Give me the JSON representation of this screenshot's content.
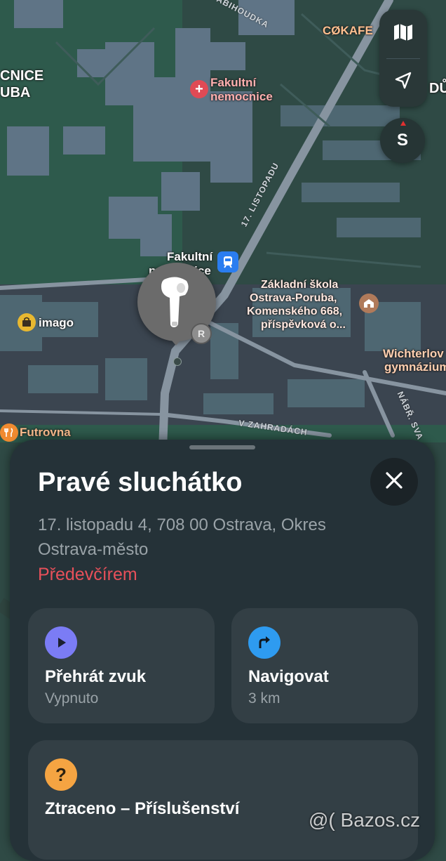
{
  "map": {
    "labels": {
      "hospital_left_line1": "CNICE",
      "hospital_left_line2": "UBA",
      "fakultni_nemocnice_line1": "Fakultní",
      "fakultni_nemocnice_line2": "nemocnice",
      "tram_stop_line1": "Fakultní",
      "tram_stop_line2": "nemocnice",
      "school_line1": "Základní škola",
      "school_line2": "Ostrava-Poruba,",
      "school_line3": "Komenského 668,",
      "school_line4": "příspěvková o...",
      "imago": "imago",
      "futrovna": "Futrovna",
      "cokafe": "CØKAFE",
      "wichterle_line1": "Wichterlov",
      "wichterle_line2": "gymnázium",
      "right_edge": "DŮ"
    },
    "streets": {
      "listopadu": "17. LISTOPADU",
      "abihoudka": "ABIHOUDKA",
      "zahradou": "V ZAHRADÁCH",
      "nabrezi": "NÁBŘ. SVA"
    },
    "icons": [
      "hospital-icon",
      "tram-icon",
      "shopping-bag-icon",
      "fork-knife-icon",
      "school-icon"
    ],
    "colors": {
      "map_bg": "#2f4a45",
      "poi_red": "#e04a55",
      "tram_blue": "#2a7df0",
      "shop_yellow": "#e8b830",
      "food_orange": "#f08a30",
      "school_brown": "#b07a5a"
    }
  },
  "controls": {
    "map_mode_icon": "map-icon",
    "location_icon": "location-arrow-icon",
    "compass_label": "S"
  },
  "pin": {
    "device_icon": "airpod-icon",
    "badge": "R"
  },
  "sheet": {
    "title": "Pravé sluchátko",
    "address": "17. listopadu 4, 708 00 Ostrava, Okres Ostrava-město",
    "last_seen": "Předevčírem",
    "close_icon": "close-icon",
    "actions": [
      {
        "title": "Přehrát zvuk",
        "subtitle": "Vypnuto",
        "icon": "play-icon",
        "color": "#7b7cf5"
      },
      {
        "title": "Navigovat",
        "subtitle": "3 km",
        "icon": "turn-right-arrow-icon",
        "color": "#2e9bf0"
      }
    ],
    "lost": {
      "title": "Ztraceno – Příslušenství",
      "icon": "question-icon",
      "color": "#f5a442"
    }
  },
  "watermark": "@( Bazos.cz"
}
